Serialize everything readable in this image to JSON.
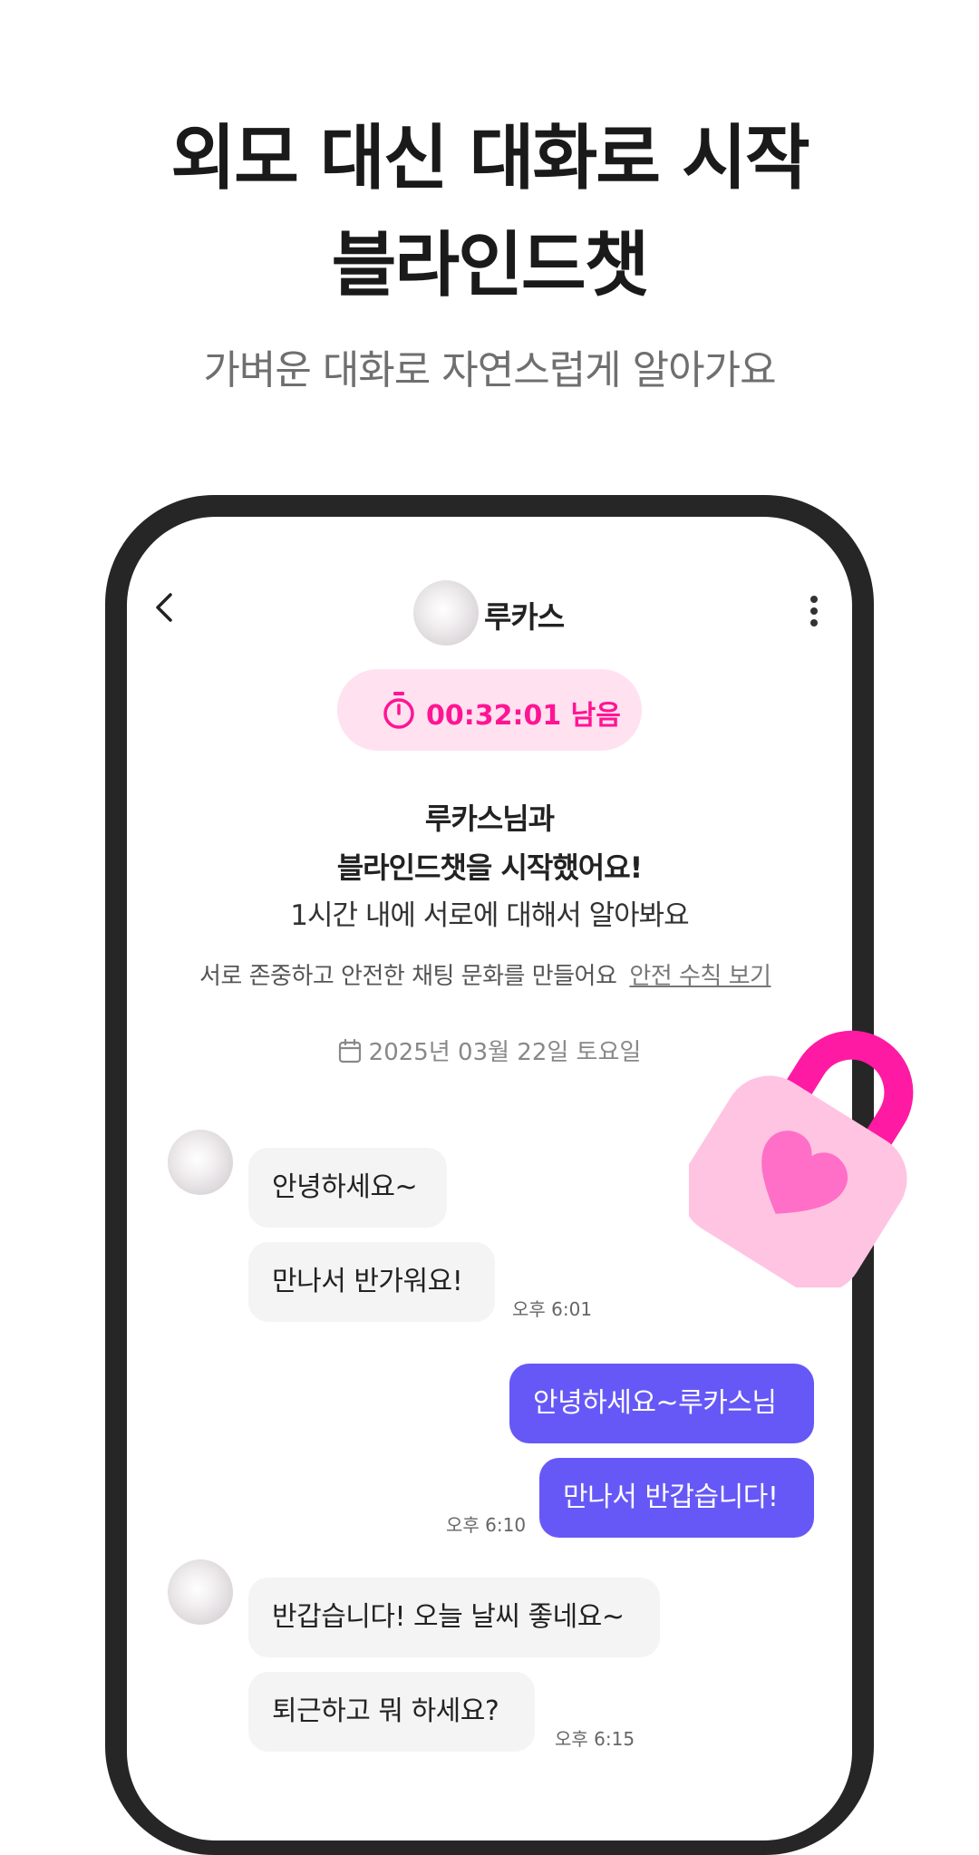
{
  "promo": {
    "headline_line1": "외모 대신 대화로 시작",
    "headline_line2": "블라인드챗",
    "subheadline": "가벼운 대화로 자연스럽게 알아가요"
  },
  "chat_header": {
    "back_icon": "chevron-left-icon",
    "name": "루카스",
    "more_icon": "more-vertical-icon"
  },
  "timer": {
    "icon": "stopwatch-icon",
    "text": "00:32:01 남음",
    "color": "#ff1493",
    "background": "#ffe1f0"
  },
  "intro": {
    "line1": "루카스님과",
    "line2": "블라인드챗을 시작했어요!",
    "line3": "1시간 내에 서로에 대해서 알아봐요"
  },
  "notice": {
    "text": "서로 존중하고 안전한 채팅 문화를 만들어요",
    "link": "안전 수칙 보기"
  },
  "date": {
    "icon": "calendar-icon",
    "text": "2025년 03월 22일 토요일"
  },
  "messages": [
    {
      "side": "in",
      "text": "안녕하세요~"
    },
    {
      "side": "in",
      "text": "만나서 반가워요!",
      "time": "오후 6:01"
    },
    {
      "side": "out",
      "text": "안녕하세요~루카스님"
    },
    {
      "side": "out",
      "text": "만나서 반갑습니다!",
      "time": "오후 6:10"
    },
    {
      "side": "in",
      "text": "반갑습니다! 오늘 날씨 좋네요~"
    },
    {
      "side": "in",
      "text": "퇴근하고 뭐 하세요?",
      "time": "오후 6:15"
    }
  ],
  "decoration": {
    "icon": "heart-padlock-icon",
    "accent": "#ff1aa3",
    "body": "#ffc4e1",
    "heart": "#ff6ec7"
  },
  "colors": {
    "outgoing_bubble": "#6658f7",
    "incoming_bubble": "#f4f4f5"
  }
}
